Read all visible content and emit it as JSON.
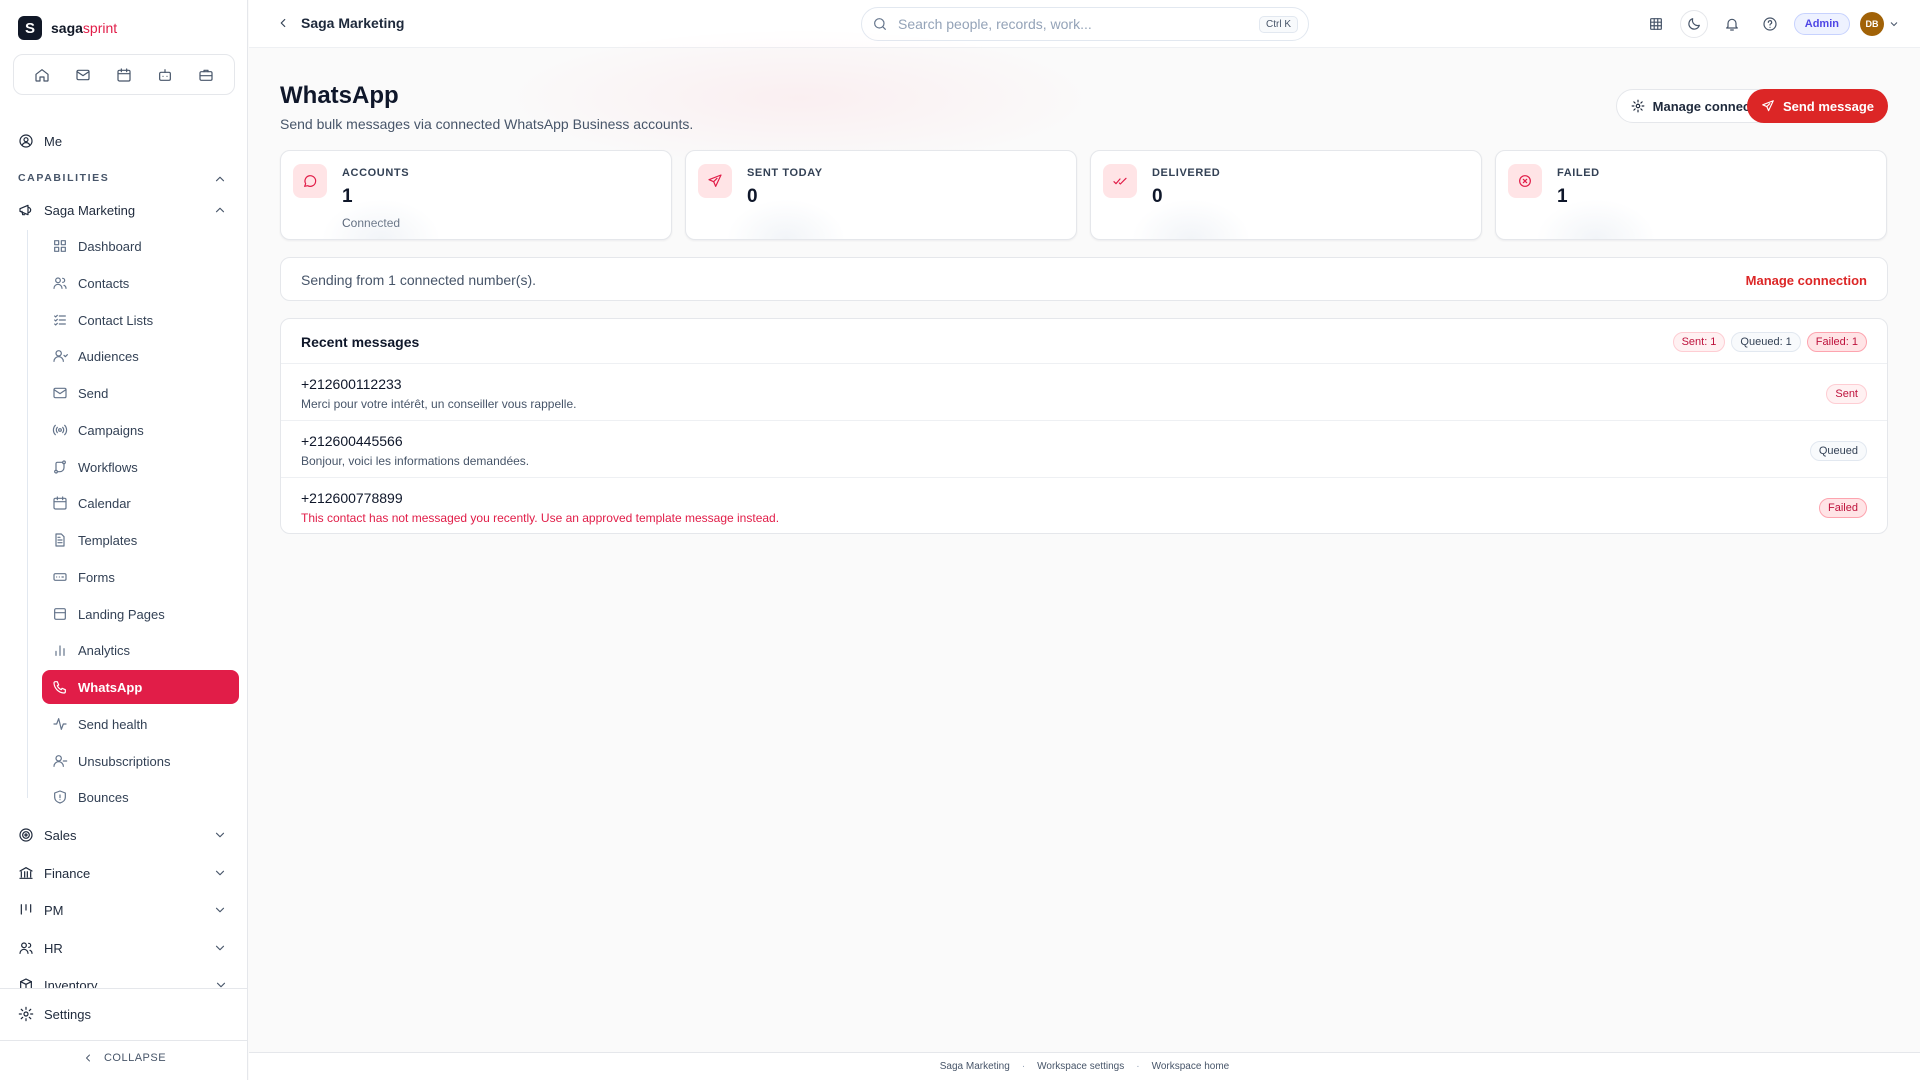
{
  "brand": {
    "name_main": "saga",
    "name_accent": "sprint",
    "logo_letter": "S"
  },
  "sidebar": {
    "me_label": "Me",
    "capabilities_label": "CAPABILITIES",
    "group_title": "Saga Marketing",
    "items": [
      {
        "label": "Dashboard",
        "icon": "grid-icon"
      },
      {
        "label": "Contacts",
        "icon": "users-icon"
      },
      {
        "label": "Contact Lists",
        "icon": "list-check-icon"
      },
      {
        "label": "Audiences",
        "icon": "audience-icon"
      },
      {
        "label": "Send",
        "icon": "mail-icon"
      },
      {
        "label": "Campaigns",
        "icon": "broadcast-icon"
      },
      {
        "label": "Workflows",
        "icon": "workflow-icon"
      },
      {
        "label": "Calendar",
        "icon": "calendar-icon"
      },
      {
        "label": "Templates",
        "icon": "file-icon"
      },
      {
        "label": "Forms",
        "icon": "form-icon"
      },
      {
        "label": "Landing Pages",
        "icon": "layout-icon"
      },
      {
        "label": "Analytics",
        "icon": "bar-chart-icon"
      },
      {
        "label": "WhatsApp",
        "icon": "phone-icon"
      },
      {
        "label": "Send health",
        "icon": "activity-icon"
      },
      {
        "label": "Unsubscriptions",
        "icon": "user-minus-icon"
      },
      {
        "label": "Bounces",
        "icon": "shield-icon"
      }
    ],
    "active_item": "WhatsApp",
    "sections": [
      {
        "label": "Sales",
        "icon": "target-icon"
      },
      {
        "label": "Finance",
        "icon": "bank-icon"
      },
      {
        "label": "PM",
        "icon": "kanban-icon"
      },
      {
        "label": "HR",
        "icon": "people-icon"
      },
      {
        "label": "Inventory",
        "icon": "box-icon"
      }
    ],
    "settings_label": "Settings",
    "collapse_label": "COLLAPSE"
  },
  "topbar": {
    "breadcrumb": "Saga Marketing",
    "search_placeholder": "Search people, records, work...",
    "search_shortcut": "Ctrl K",
    "role_badge": "Admin",
    "avatar_initials": "DB"
  },
  "page": {
    "title": "WhatsApp",
    "subtitle": "Send bulk messages via connected WhatsApp Business accounts.",
    "manage_button": "Manage connection",
    "send_button": "Send message"
  },
  "stats": [
    {
      "label": "ACCOUNTS",
      "value": "1",
      "sub": "Connected",
      "icon": "chat-bubble-icon"
    },
    {
      "label": "SENT TODAY",
      "value": "0",
      "sub": "",
      "icon": "send-icon"
    },
    {
      "label": "DELIVERED",
      "value": "0",
      "sub": "",
      "icon": "double-check-icon"
    },
    {
      "label": "FAILED",
      "value": "1",
      "sub": "",
      "icon": "x-circle-icon"
    }
  ],
  "info": {
    "text": "Sending from 1 connected number(s).",
    "link": "Manage connection"
  },
  "recent": {
    "title": "Recent messages",
    "counts": {
      "sent": "Sent: 1",
      "queued": "Queued: 1",
      "failed": "Failed: 1"
    },
    "messages": [
      {
        "phone": "+212600112233",
        "text": "Merci pour votre intérêt, un conseiller vous rappelle.",
        "status": "Sent"
      },
      {
        "phone": "+212600445566",
        "text": "Bonjour, voici les informations demandées.",
        "status": "Queued"
      },
      {
        "phone": "+212600778899",
        "text": "This contact has not messaged you recently. Use an approved template message instead.",
        "status": "Failed"
      }
    ]
  },
  "footer": {
    "links": [
      "Saga Marketing",
      "Workspace settings",
      "Workspace home"
    ]
  },
  "colors": {
    "accent": "#e11d48",
    "primary_button": "#dc2626",
    "admin": "#4f46e5"
  }
}
